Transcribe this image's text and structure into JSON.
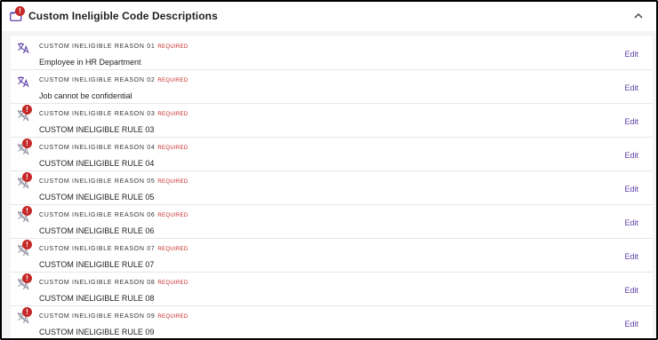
{
  "panel": {
    "title": "Custom Ineligible Code Descriptions",
    "badge": "!",
    "icon": "folder-icon",
    "collapse_icon": "chevron-up-icon"
  },
  "rows": [
    {
      "label": "CUSTOM INELIGIBLE REASON 01",
      "required": "REQUIRED",
      "value": "Employee in HR Department",
      "edit": "Edit",
      "icon": "translate-icon",
      "error": false
    },
    {
      "label": "CUSTOM INELIGIBLE REASON 02",
      "required": "REQUIRED",
      "value": "Job cannot be confidential",
      "edit": "Edit",
      "icon": "translate-icon",
      "error": false
    },
    {
      "label": "CUSTOM INELIGIBLE REASON 03",
      "required": "REQUIRED",
      "value": "CUSTOM INELIGIBLE RULE 03",
      "edit": "Edit",
      "icon": "translate-off-icon",
      "error": true,
      "badge": "!"
    },
    {
      "label": "CUSTOM INELIGIBLE REASON 04",
      "required": "REQUIRED",
      "value": "CUSTOM INELIGIBLE RULE 04",
      "edit": "Edit",
      "icon": "translate-off-icon",
      "error": true,
      "badge": "!"
    },
    {
      "label": "CUSTOM INELIGIBLE REASON 05",
      "required": "REQUIRED",
      "value": "CUSTOM INELIGIBLE RULE 05",
      "edit": "Edit",
      "icon": "translate-off-icon",
      "error": true,
      "badge": "!"
    },
    {
      "label": "CUSTOM INELIGIBLE REASON 06",
      "required": "REQUIRED",
      "value": "CUSTOM INELIGIBLE RULE 06",
      "edit": "Edit",
      "icon": "translate-off-icon",
      "error": true,
      "badge": "!"
    },
    {
      "label": "CUSTOM INELIGIBLE REASON 07",
      "required": "REQUIRED",
      "value": "CUSTOM INELIGIBLE RULE 07",
      "edit": "Edit",
      "icon": "translate-off-icon",
      "error": true,
      "badge": "!"
    },
    {
      "label": "CUSTOM INELIGIBLE REASON 08",
      "required": "REQUIRED",
      "value": "CUSTOM INELIGIBLE RULE 08",
      "edit": "Edit",
      "icon": "translate-off-icon",
      "error": true,
      "badge": "!"
    },
    {
      "label": "CUSTOM INELIGIBLE REASON 09",
      "required": "REQUIRED",
      "value": "CUSTOM INELIGIBLE RULE 09",
      "edit": "Edit",
      "icon": "translate-off-icon",
      "error": true,
      "badge": "!"
    }
  ],
  "colors": {
    "error": "#c62828",
    "link": "#5b3ea8",
    "icon": "#5b3ea8",
    "icon_muted": "#9a9aa8"
  }
}
